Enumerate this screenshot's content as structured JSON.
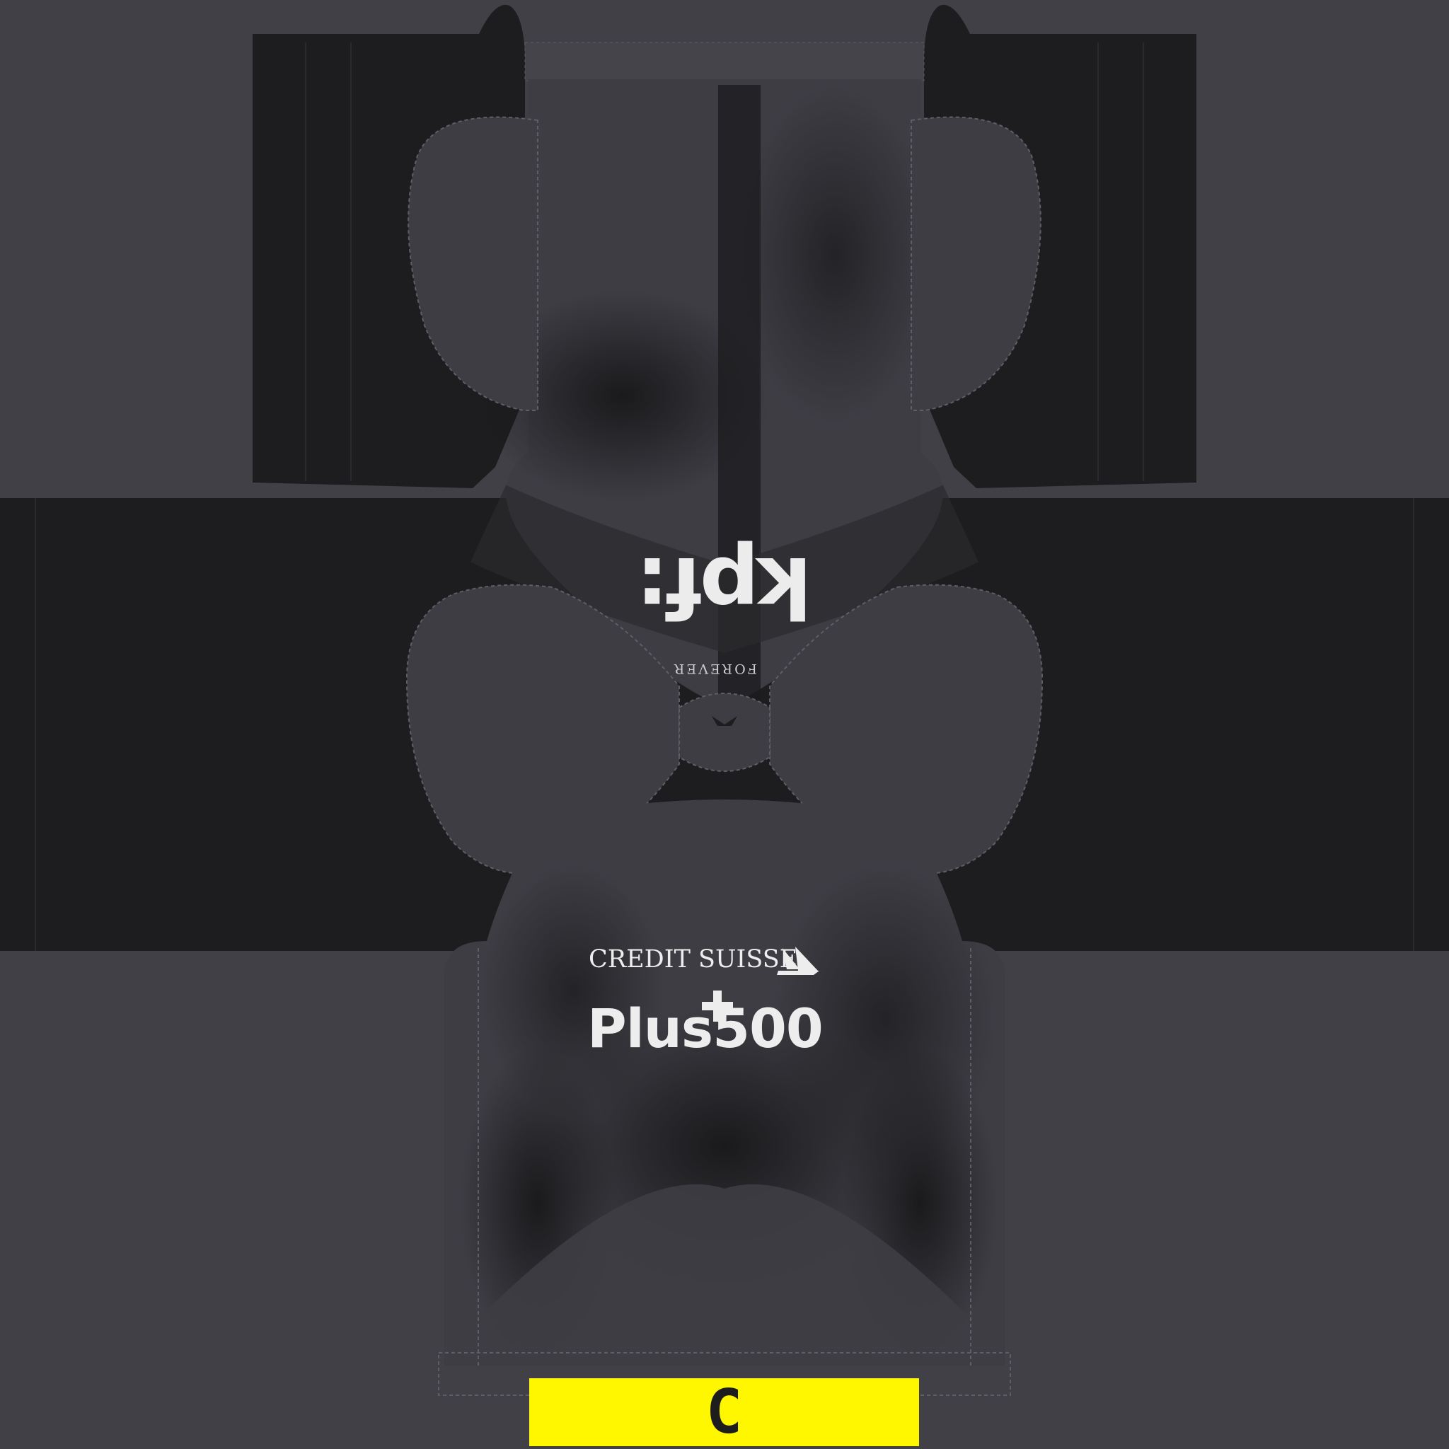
{
  "texture": {
    "colors": {
      "background": "#414047",
      "panel_dark": "#1d1d1f",
      "panel_mid": "#3e3d44",
      "stitch": "#6b6a72",
      "logo_white": "#ededed",
      "captain_yellow": "#fff700",
      "captain_text": "#1d1d1d"
    },
    "back_sponsor": "kpf:",
    "collar_tag": "FOREVER",
    "front_sponsor_primary": "CREDIT SUISSE",
    "front_sponsor_secondary": "Plus500",
    "captain_band_letter": "C"
  }
}
